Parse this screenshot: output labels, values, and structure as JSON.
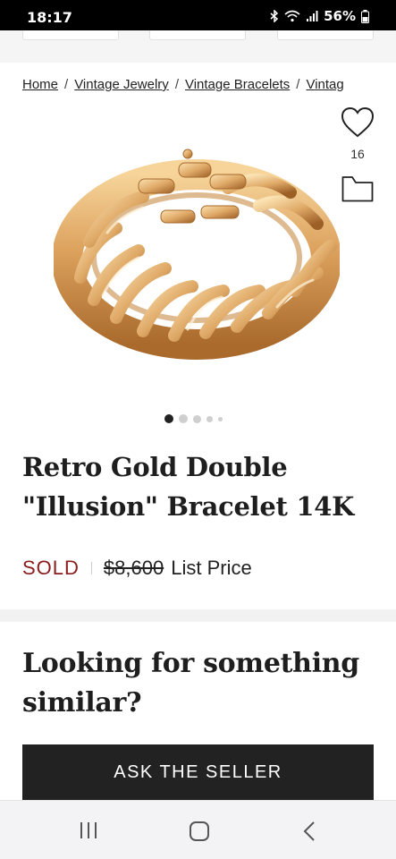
{
  "status_bar": {
    "time": "18:17",
    "battery": "56%"
  },
  "breadcrumb": {
    "items": [
      "Home",
      "Vintage Jewelry",
      "Vintage Bracelets",
      "Vintag"
    ],
    "separator": "/"
  },
  "favorite": {
    "count": "16"
  },
  "product": {
    "title_line1": "Retro Gold Double",
    "title_line2": "\"Illusion\" Bracelet 14K",
    "status": "SOLD",
    "price": "$8,600",
    "price_label": "List Price",
    "image_dots": 5,
    "active_dot": 0
  },
  "similar_section": {
    "heading_line1": "Looking for something",
    "heading_line2": "similar?",
    "button_label": "ASK THE SELLER"
  },
  "colors": {
    "sold": "#8a1c1c",
    "button_bg": "#222222",
    "gold": "#d9a15a"
  },
  "icons": [
    "heart-icon",
    "folder-icon",
    "bluetooth-icon",
    "wifi-icon",
    "signal-icon",
    "battery-icon",
    "recent-apps-icon",
    "home-icon",
    "back-icon"
  ]
}
